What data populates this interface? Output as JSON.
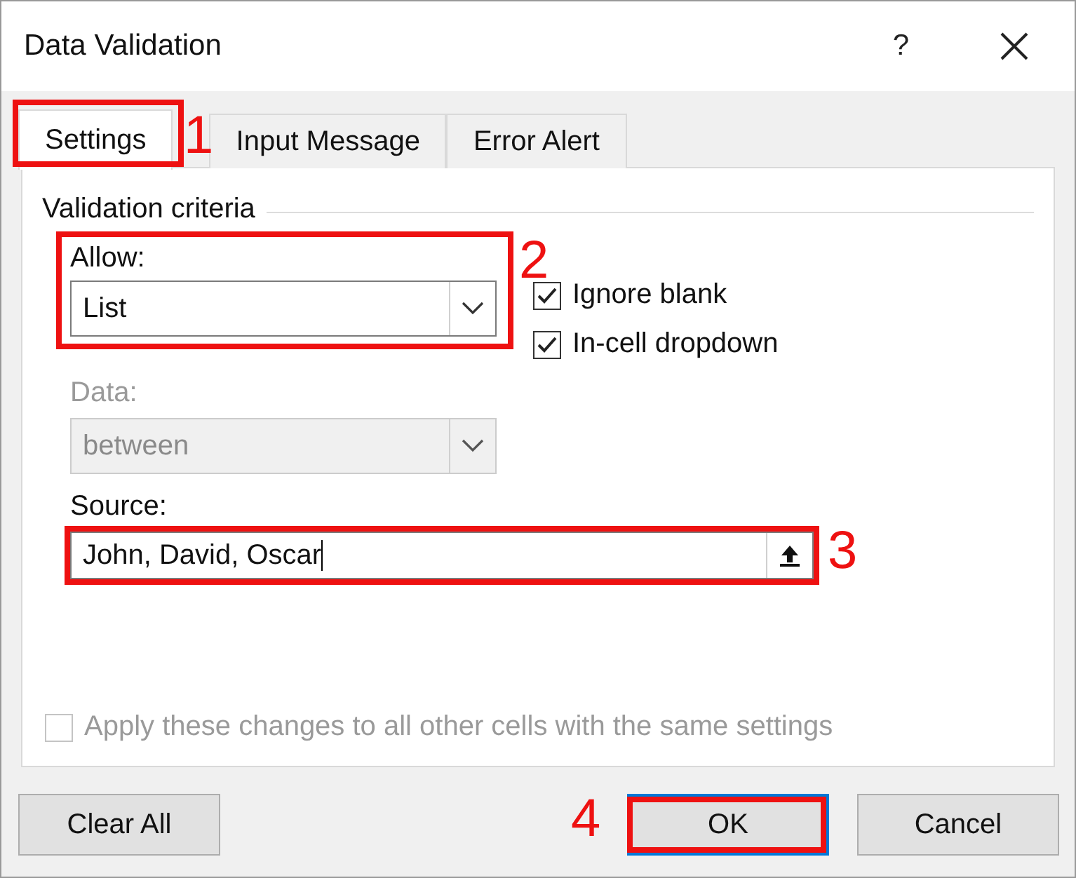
{
  "window": {
    "title": "Data Validation",
    "help": "?"
  },
  "tabs": [
    {
      "label": "Settings",
      "selected": true,
      "annotation": "1"
    },
    {
      "label": "Input Message",
      "selected": false
    },
    {
      "label": "Error Alert",
      "selected": false
    }
  ],
  "criteria": {
    "heading": "Validation criteria",
    "allow": {
      "label": "Allow:",
      "value": "List",
      "annotation": "2"
    },
    "checkboxes": [
      {
        "label": "Ignore blank",
        "checked": true
      },
      {
        "label": "In-cell dropdown",
        "checked": true
      }
    ],
    "data": {
      "label": "Data:",
      "value": "between",
      "disabled": true
    },
    "source": {
      "label": "Source:",
      "value": "John, David, Oscar",
      "annotation": "3"
    }
  },
  "apply": {
    "label": "Apply these changes to all other cells with the same settings",
    "checked": false,
    "disabled": true
  },
  "buttons": [
    {
      "label": "Clear All",
      "kind": "plain"
    },
    {
      "label": "OK",
      "kind": "default",
      "annotation": "4"
    },
    {
      "label": "Cancel",
      "kind": "plain"
    }
  ]
}
